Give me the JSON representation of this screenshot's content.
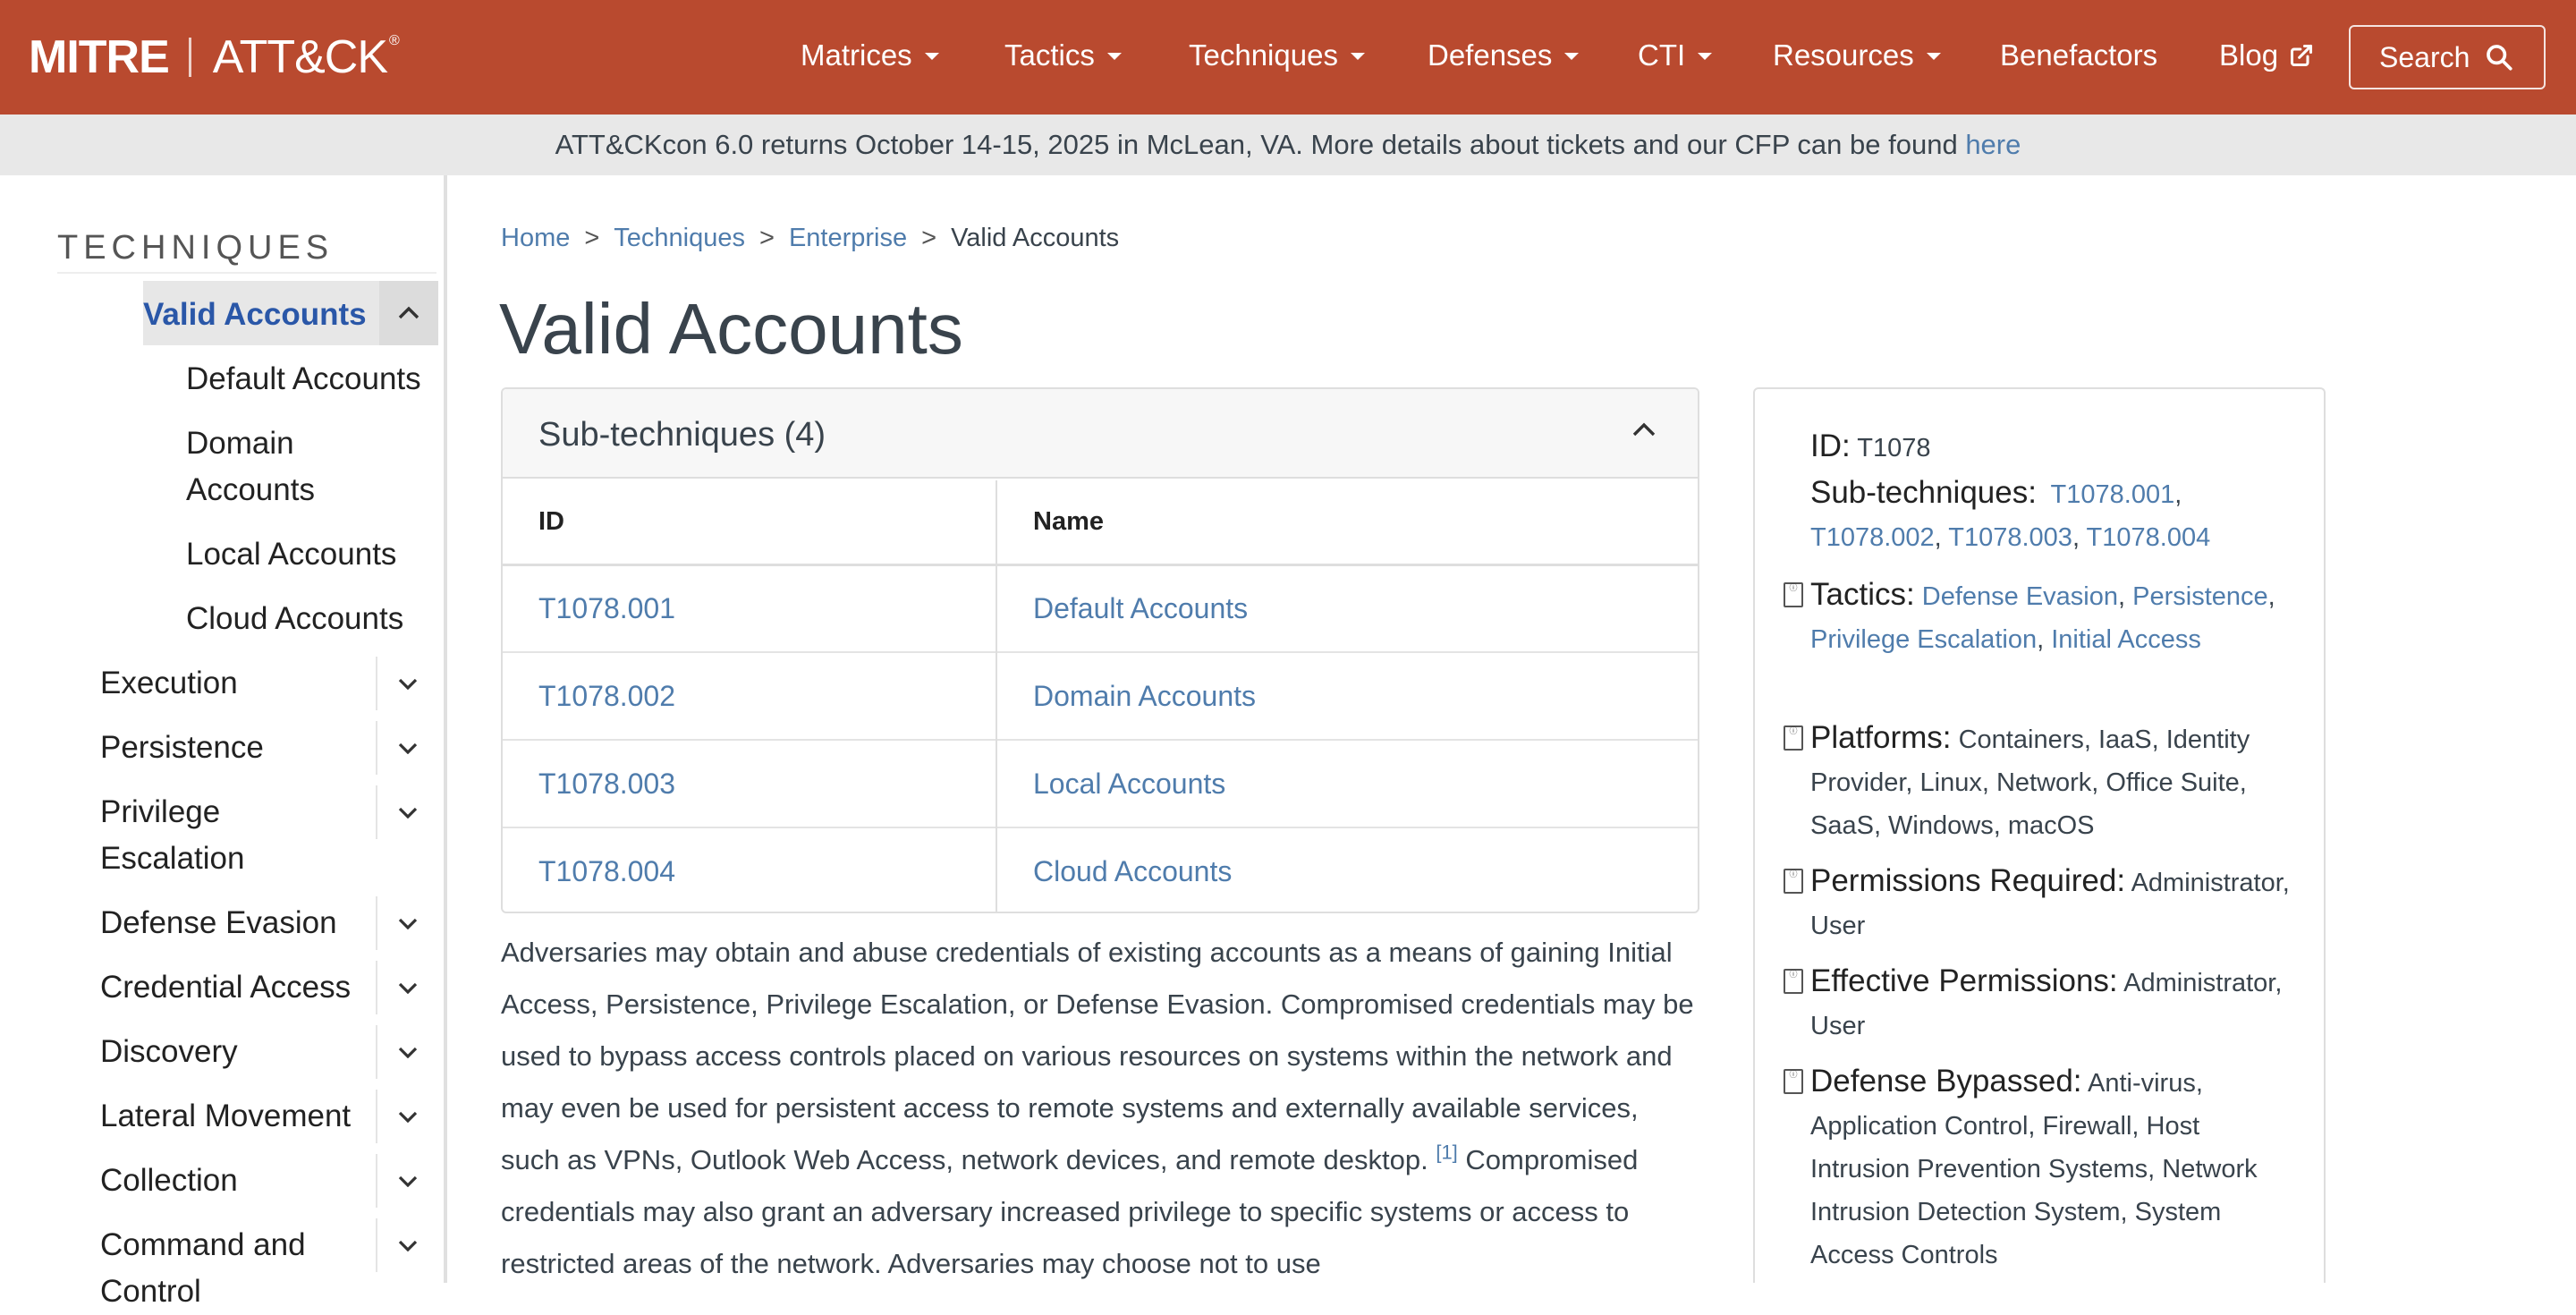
{
  "navbar": {
    "brand_mitre": "MITRE",
    "brand_attck": "ATT&CK",
    "brand_reg": "®",
    "items": [
      {
        "label": "Matrices"
      },
      {
        "label": "Tactics"
      },
      {
        "label": "Techniques"
      },
      {
        "label": "Defenses"
      },
      {
        "label": "CTI"
      },
      {
        "label": "Resources"
      },
      {
        "label": "Benefactors"
      },
      {
        "label": "Blog"
      }
    ],
    "search_label": "Search"
  },
  "banner": {
    "text": "ATT&CKcon 6.0 returns October 14-15, 2025 in McLean, VA. More details about tickets and our CFP can be found ",
    "link_label": "here"
  },
  "sidebar": {
    "heading": "TECHNIQUES",
    "active": "Valid Accounts",
    "subitems": [
      "Default Accounts",
      "Domain Accounts",
      "Local Accounts",
      "Cloud Accounts"
    ],
    "tactics": [
      "Execution",
      "Persistence",
      "Privilege Escalation",
      "Defense Evasion",
      "Credential Access",
      "Discovery",
      "Lateral Movement",
      "Collection",
      "Command and Control"
    ]
  },
  "breadcrumb": {
    "home": "Home",
    "techniques": "Techniques",
    "enterprise": "Enterprise",
    "current": "Valid Accounts",
    "separator": ">"
  },
  "page_title": "Valid Accounts",
  "subtechniques": {
    "title": "Sub-techniques (4)",
    "col_id": "ID",
    "col_name": "Name",
    "rows": [
      {
        "id": "T1078.001",
        "name": "Default Accounts"
      },
      {
        "id": "T1078.002",
        "name": "Domain Accounts"
      },
      {
        "id": "T1078.003",
        "name": "Local Accounts"
      },
      {
        "id": "T1078.004",
        "name": "Cloud Accounts"
      }
    ]
  },
  "description": {
    "part1": "Adversaries may obtain and abuse credentials of existing accounts as a means of gaining Initial Access, Persistence, Privilege Escalation, or Defense Evasion. Compromised credentials may be used to bypass access controls placed on various resources on systems within the network and may even be used for persistent access to remote systems and externally available services, such as VPNs, Outlook Web Access, network devices, and remote desktop.",
    "ref1": "[1]",
    "part2": " Compromised credentials may also grant an adversary increased privilege to specific systems or access to restricted areas of the network. Adversaries may choose not to use"
  },
  "info": {
    "id_label": "ID:",
    "id_value": "T1078",
    "subtech_label": "Sub-techniques:",
    "subtech_links": [
      "T1078.001",
      "T1078.002",
      "T1078.003",
      "T1078.004"
    ],
    "tactics_label": "Tactics:",
    "tactics_links": [
      "Defense Evasion",
      "Persistence",
      "Privilege Escalation",
      "Initial Access"
    ],
    "platforms_label": "Platforms:",
    "platforms_value": "Containers, IaaS, Identity Provider, Linux, Network, Office Suite, SaaS, Windows, macOS",
    "permissions_label": "Permissions Required:",
    "permissions_value": "Administrator, User",
    "effective_label": "Effective Permissions:",
    "effective_value": "Administrator, User",
    "bypassed_label": "Defense Bypassed:",
    "bypassed_value": "Anti-virus, Application Control, Firewall, Host Intrusion Prevention Systems, Network Intrusion Detection System, System Access Controls",
    "icon_glyph": "ⓘ"
  },
  "colors": {
    "navbar": "#b94a2f",
    "link": "#4f7cac",
    "active_link": "#2a57a8",
    "text": "#39434c"
  }
}
